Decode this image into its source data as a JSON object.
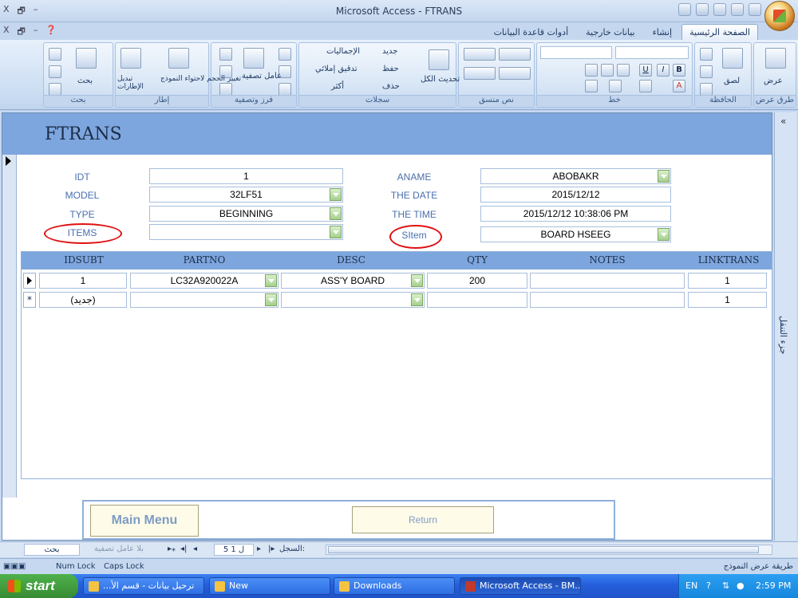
{
  "window": {
    "title": "Microsoft Access - FTRANS",
    "left_controls": [
      "X",
      "🗗",
      "–"
    ],
    "doc_controls": [
      "X",
      "🗗",
      "–",
      "❓"
    ]
  },
  "ribbon_tabs": [
    "الصفحة الرئيسية",
    "إنشاء",
    "بيانات خارجية",
    "أدوات قاعدة البيانات"
  ],
  "ribbon": {
    "views": {
      "label": "عرض",
      "group": "طرق عرض"
    },
    "clipboard": {
      "paste": "لصق",
      "group": "الحافظة"
    },
    "font": {
      "group": "خط",
      "bold": "B",
      "italic": "I",
      "underline": "U",
      "color_a": "A"
    },
    "rich_text": {
      "group": "نص منسق"
    },
    "records": {
      "refresh": "تحديث الكل",
      "new": "جديد",
      "save": "حفظ",
      "delete": "حذف",
      "totals": "الإجماليات",
      "spelling": "تدقيق إملائي",
      "more": "أكثر",
      "group": "سجلات"
    },
    "sort_filter": {
      "filter": "عامل تصفية",
      "group": "فرز وتصفية"
    },
    "window": {
      "switch": "تبديل الإطارات",
      "size": "تغيير الحجم لاحتواء النموذج",
      "group": "إطار"
    },
    "find": {
      "find": "بحث",
      "group": "بحث"
    }
  },
  "form": {
    "title": "FTRANS",
    "labels": {
      "idt": "IDT",
      "model": "MODEL",
      "type": "TYPE",
      "items": "ITEMS",
      "aname": "ANAME",
      "the_date": "THE DATE",
      "the_time": "THE TIME",
      "sitem": "SItem"
    },
    "values": {
      "idt": "1",
      "model": "32LF51",
      "type": "BEGINNING",
      "items": "",
      "aname": "ABOBAKR",
      "the_date": "2015/12/12",
      "the_time": "2015/12/12 10:38:06 PM",
      "sitem": "BOARD HSEEG"
    },
    "subform": {
      "columns": [
        "IDSUBT",
        "PARTNO",
        "DESC",
        "QTY",
        "NOTES",
        "LINKTRANS"
      ],
      "rows": [
        {
          "marker": "▶",
          "idsubt": "1",
          "partno": "LC32A920022A",
          "desc": "ASS'Y BOARD",
          "qty": "200",
          "notes": "",
          "linktrans": "1"
        },
        {
          "marker": "*",
          "idsubt": "(جديد)",
          "partno": "",
          "desc": "",
          "qty": "",
          "notes": "",
          "linktrans": "1"
        }
      ]
    },
    "buttons": {
      "main_menu": "Main Menu",
      "return": "Return"
    },
    "nav_pane_label": "جزء التنقل",
    "nav_pane_toggle": "«"
  },
  "navbar": {
    "record_label": "السجل:",
    "record_value": "5 ل 1",
    "no_filter": "بلا عامل تصفية",
    "search": "بحث"
  },
  "statusbar": {
    "view": "طريقة عرض النموذج",
    "num_lock": "Num Lock",
    "caps_lock": "Caps Lock"
  },
  "taskbar": {
    "start": "start",
    "buttons": [
      "...ترحيل بيانات - قسم الأ",
      "New",
      "Downloads",
      "Microsoft Access - BM..."
    ],
    "lang": "EN",
    "time": "2:59 PM"
  },
  "colors": {
    "form_header": "#7ea6de",
    "label_text": "#4a6fae",
    "annotation_circle": "#e01010",
    "taskbar": "#245edb"
  }
}
